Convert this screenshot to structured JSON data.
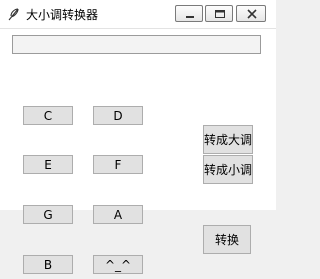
{
  "window": {
    "title": "大小调转换器"
  },
  "display": {
    "value": ""
  },
  "keys": {
    "c": "C",
    "d": "D",
    "e": "E",
    "f": "F",
    "g": "G",
    "a": "A",
    "b": "B",
    "caret": "^_^"
  },
  "actions": {
    "to_major": "转成大调",
    "to_minor": "转成小调",
    "convert": "转换"
  },
  "colors": {
    "button_face": "#e1e1e1",
    "button_border": "#adadad",
    "window_bg": "#ffffff",
    "panel_bg": "#f0f0f0"
  }
}
